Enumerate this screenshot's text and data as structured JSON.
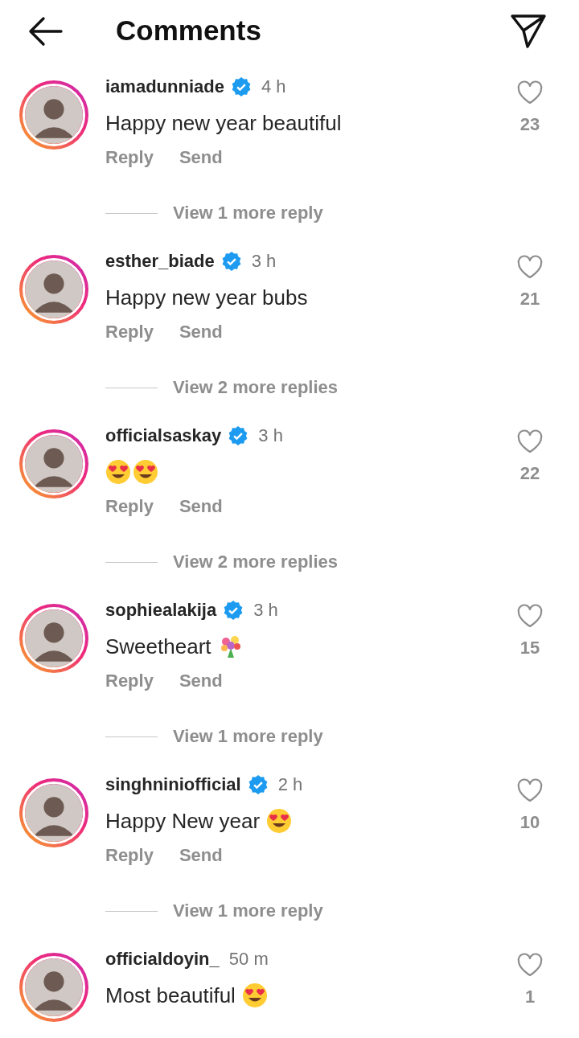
{
  "header": {
    "title": "Comments"
  },
  "comments": [
    {
      "username": "iamadunniade",
      "verified": true,
      "time": "4 h",
      "text": "Happy new year beautiful",
      "likes": "23",
      "actions": [
        "Reply",
        "Send"
      ],
      "view_replies": "View 1 more reply"
    },
    {
      "username": "esther_biade",
      "verified": true,
      "time": "3 h",
      "text": "Happy new year bubs",
      "likes": "21",
      "actions": [
        "Reply",
        "Send"
      ],
      "view_replies": "View 2 more replies"
    },
    {
      "username": "officialsaskay",
      "verified": true,
      "time": "3 h",
      "emojis": [
        {
          "kind": "heart_eyes"
        },
        {
          "kind": "heart_eyes"
        }
      ],
      "likes": "22",
      "actions": [
        "Reply",
        "Send"
      ],
      "view_replies": "View 2 more replies"
    },
    {
      "username": "sophiealakija",
      "verified": true,
      "time": "3 h",
      "text": "Sweetheart",
      "emojis": [
        {
          "kind": "bouquet"
        }
      ],
      "likes": "15",
      "actions": [
        "Reply",
        "Send"
      ],
      "view_replies": "View 1 more reply"
    },
    {
      "username": "singhniniofficial",
      "verified": true,
      "time": "2 h",
      "text": "Happy New year",
      "emojis": [
        {
          "kind": "heart_eyes"
        }
      ],
      "likes": "10",
      "actions": [
        "Reply",
        "Send"
      ],
      "view_replies": "View 1 more reply"
    },
    {
      "username": "officialdoyin_",
      "verified": false,
      "time": "50 m",
      "text": "Most beautiful",
      "emojis": [
        {
          "kind": "heart_eyes"
        }
      ],
      "likes": "1"
    }
  ]
}
